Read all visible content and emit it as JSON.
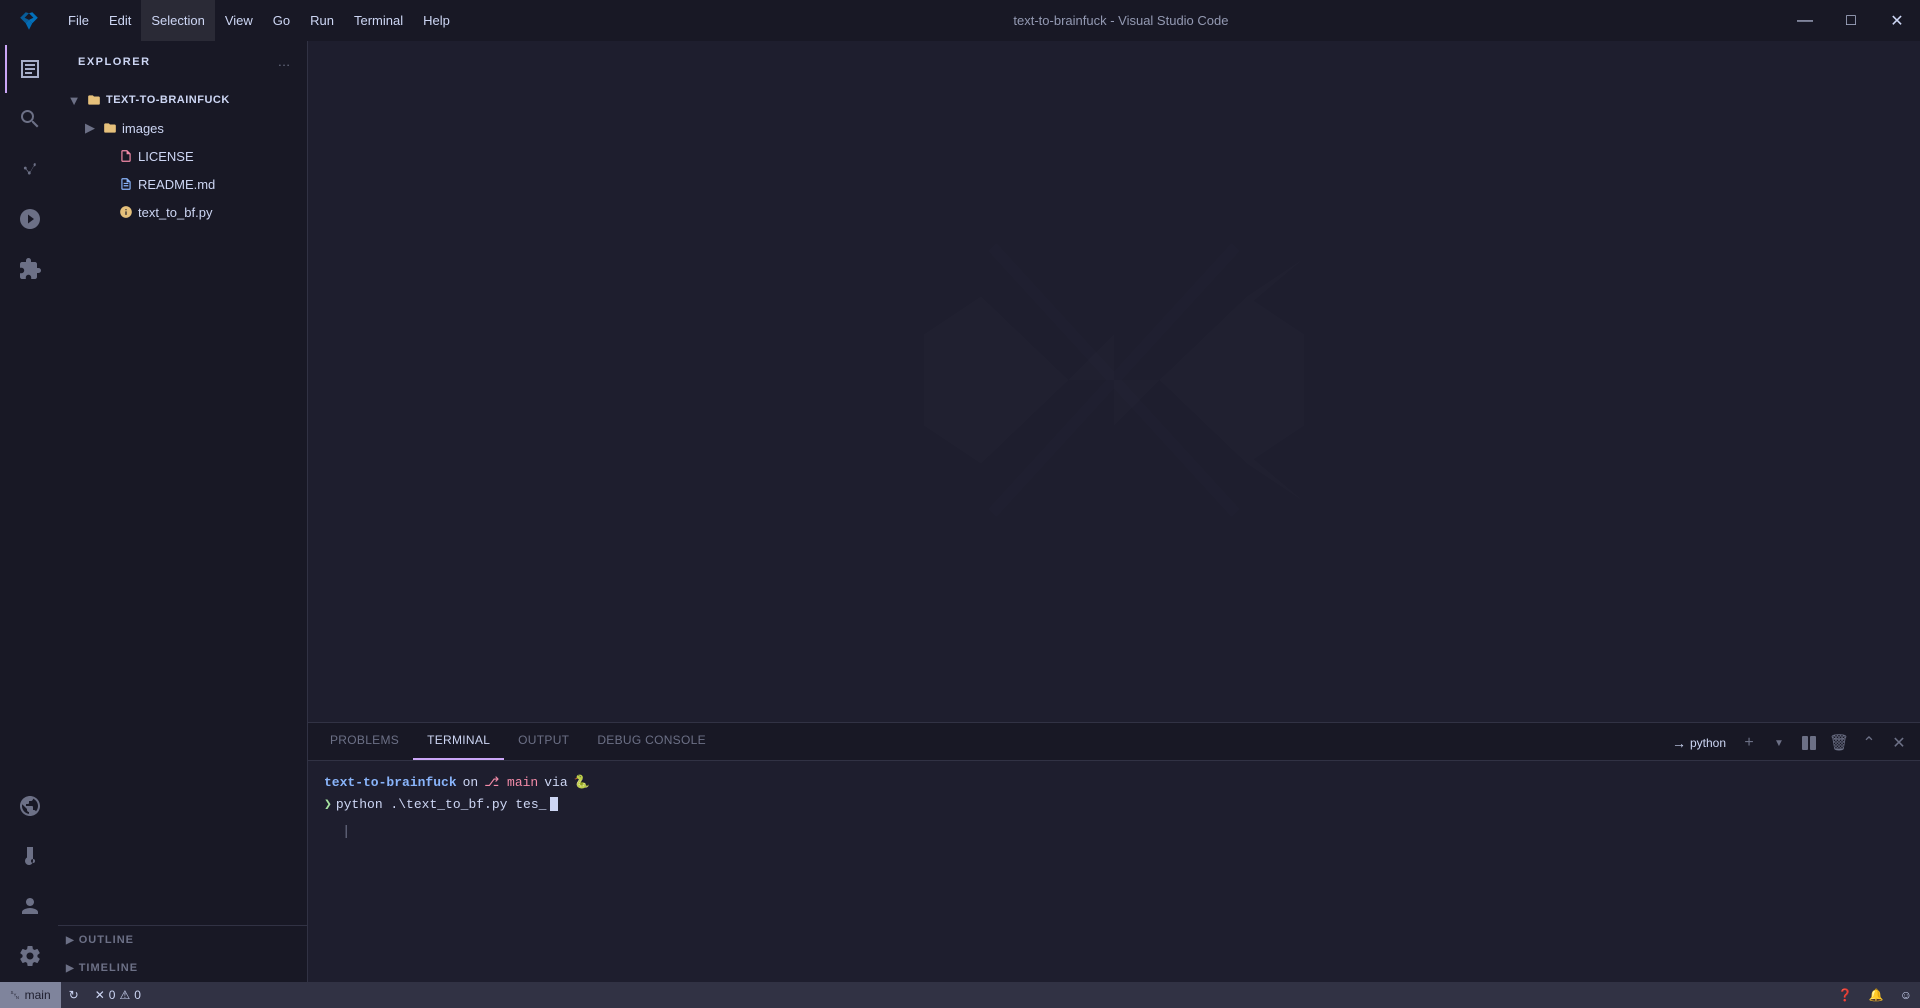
{
  "titlebar": {
    "title": "text-to-brainfuck - Visual Studio Code",
    "menu": [
      "File",
      "Edit",
      "Selection",
      "View",
      "Go",
      "Run",
      "Terminal",
      "Help"
    ],
    "window_controls": [
      "minimize",
      "maximize",
      "close"
    ]
  },
  "activity_bar": {
    "items": [
      {
        "id": "explorer",
        "icon": "files-icon",
        "active": true
      },
      {
        "id": "search",
        "icon": "search-icon",
        "active": false
      },
      {
        "id": "source-control",
        "icon": "source-control-icon",
        "active": false
      },
      {
        "id": "run-debug",
        "icon": "debug-icon",
        "active": false
      },
      {
        "id": "extensions",
        "icon": "extensions-icon",
        "active": false
      },
      {
        "id": "remote",
        "icon": "remote-icon",
        "active": false
      },
      {
        "id": "flask",
        "icon": "flask-icon",
        "active": false
      }
    ],
    "bottom_items": [
      {
        "id": "extensions-bottom",
        "icon": "puzzle-icon"
      },
      {
        "id": "accounts",
        "icon": "account-icon"
      },
      {
        "id": "settings",
        "icon": "gear-icon"
      }
    ]
  },
  "sidebar": {
    "title": "Explorer",
    "more_actions_label": "...",
    "project": {
      "name": "TEXT-TO-BRAINFUCK",
      "items": [
        {
          "type": "folder",
          "name": "images",
          "expanded": false
        },
        {
          "type": "file",
          "name": "LICENSE",
          "icon": "license-icon"
        },
        {
          "type": "file",
          "name": "README.md",
          "icon": "readme-icon"
        },
        {
          "type": "file",
          "name": "text_to_bf.py",
          "icon": "python-icon"
        }
      ]
    },
    "sections": [
      {
        "label": "OUTLINE"
      },
      {
        "label": "TIMELINE"
      }
    ]
  },
  "panel": {
    "tabs": [
      "PROBLEMS",
      "TERMINAL",
      "OUTPUT",
      "DEBUG CONSOLE"
    ],
    "active_tab": "TERMINAL",
    "python_label": "python",
    "terminal_content": {
      "line1_project": "text-to-brainfuck",
      "line1_on": "on",
      "line1_branch": " main",
      "line1_via": "via",
      "line1_icon": "🐍",
      "line2_cmd": "python .\\text_to_bf.py tes_"
    }
  },
  "status_bar": {
    "branch": "main",
    "sync_icon": "sync",
    "errors": "0",
    "warnings": "0",
    "right_items": [
      "remote-icon",
      "bell-icon",
      "smiley-icon"
    ]
  }
}
